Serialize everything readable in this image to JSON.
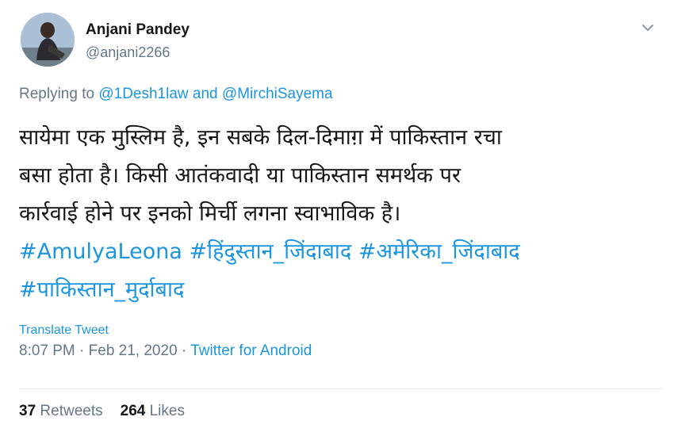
{
  "author": {
    "name": "Anjani Pandey",
    "handle": "@anjani2266"
  },
  "reply": {
    "prefix": "Replying to",
    "mention1": "@1Desh1law",
    "joiner": "and",
    "mention2": "@MirchiSayema"
  },
  "body": {
    "line1": "सायेमा एक मुस्लिम है, इन सबके दिल-दिमाग़ में पाकिस्तान रचा",
    "line2": "बसा होता है। किसी आतंकवादी या पाकिस्तान समर्थक पर",
    "line3": "कार्रवाई होने पर इनको मिर्ची लगना स्वाभाविक है।",
    "hashtags_line4": [
      "#AmulyaLeona",
      "#हिंदुस्तान_जिंदाबाद",
      "#अमेरिका_जिंदाबाद"
    ],
    "hashtags_line5": [
      "#पाकिस्तान_मुर्दाबाद"
    ]
  },
  "translate_label": "Translate Tweet",
  "meta": {
    "time": "8:07 PM",
    "separator": "·",
    "date": "Feb 21, 2020",
    "source": "Twitter for Android"
  },
  "stats": {
    "retweets_count": "37",
    "retweets_label": "Retweets",
    "likes_count": "264",
    "likes_label": "Likes"
  },
  "icons": {
    "avatar": "profile-photo",
    "more": "chevron-down-icon"
  },
  "colors": {
    "link": "#1b95e0",
    "secondary": "#657786",
    "primary": "#14171a"
  }
}
